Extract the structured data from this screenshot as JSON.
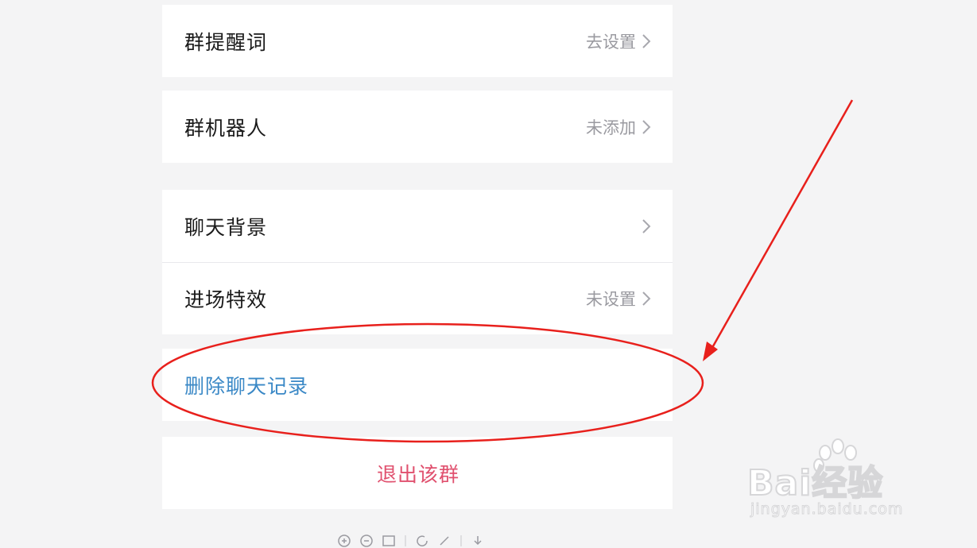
{
  "settings": {
    "reminder": {
      "label": "群提醒词",
      "value": "去设置"
    },
    "robot": {
      "label": "群机器人",
      "value": "未添加"
    },
    "background": {
      "label": "聊天背景",
      "value": ""
    },
    "entrance": {
      "label": "进场特效",
      "value": "未设置"
    },
    "delete_history": {
      "label": "删除聊天记录"
    },
    "exit_group": {
      "label": "退出该群"
    }
  },
  "colors": {
    "page_bg": "#f4f4f5",
    "link_blue": "#3a88c6",
    "danger_red": "#e0506e",
    "annotation_red": "#e8201c"
  },
  "watermark": {
    "brand": "Bai经验",
    "url": "jingyan.baidu.com"
  },
  "toolbar_icons": [
    "zoom-in-icon",
    "zoom-out-icon",
    "fit-icon",
    "rotate-icon",
    "edit-icon",
    "download-icon"
  ]
}
